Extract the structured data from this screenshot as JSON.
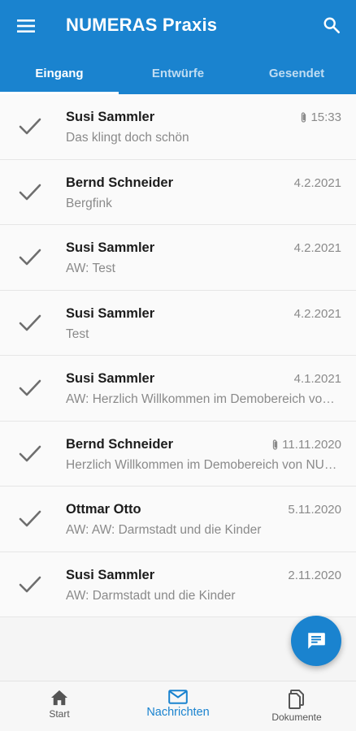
{
  "colors": {
    "primary": "#1a83cf",
    "text_primary": "#1c1c1c",
    "text_secondary": "#8a8a8a"
  },
  "header": {
    "title": "NUMERAS Praxis",
    "menu_icon": "hamburger-menu-icon",
    "search_icon": "search-icon"
  },
  "tabs": [
    {
      "label": "Eingang",
      "active": true
    },
    {
      "label": "Entwürfe",
      "active": false
    },
    {
      "label": "Gesendet",
      "active": false
    }
  ],
  "messages": [
    {
      "sender": "Susi Sammler",
      "subject": "Das klingt doch schön",
      "date": "15:33",
      "attachment": true
    },
    {
      "sender": "Bernd Schneider",
      "subject": "Bergfink",
      "date": "4.2.2021",
      "attachment": false
    },
    {
      "sender": "Susi Sammler",
      "subject": "AW: Test",
      "date": "4.2.2021",
      "attachment": false
    },
    {
      "sender": "Susi Sammler",
      "subject": "Test",
      "date": "4.2.2021",
      "attachment": false
    },
    {
      "sender": "Susi Sammler",
      "subject": "AW: Herzlich Willkommen im Demobereich von NUMERAS Praxis",
      "date": "4.1.2021",
      "attachment": false
    },
    {
      "sender": "Bernd Schneider",
      "subject": "Herzlich Willkommen im Demobereich von NUMERAS Praxis",
      "date": "11.11.2020",
      "attachment": true
    },
    {
      "sender": "Ottmar Otto",
      "subject": "AW: AW: Darmstadt und die Kinder",
      "date": "5.11.2020",
      "attachment": false
    },
    {
      "sender": "Susi Sammler",
      "subject": "AW: Darmstadt und die Kinder",
      "date": "2.11.2020",
      "attachment": false
    }
  ],
  "fab": {
    "icon": "compose-message-icon"
  },
  "bottom_nav": [
    {
      "label": "Start",
      "icon": "home-icon",
      "active": false
    },
    {
      "label": "Nachrichten",
      "icon": "mail-icon",
      "active": true
    },
    {
      "label": "Dokumente",
      "icon": "documents-icon",
      "active": false
    }
  ]
}
